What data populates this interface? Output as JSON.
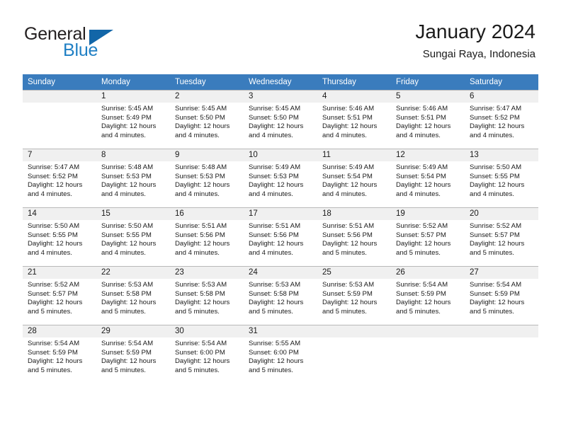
{
  "brand": {
    "name_top": "General",
    "name_bottom": "Blue",
    "triangle_icon": "blue-triangle-icon",
    "accent_color": "#1f7fc4",
    "header_color": "#3a7cbd"
  },
  "header": {
    "title": "January 2024",
    "subtitle": "Sungai Raya, Indonesia"
  },
  "calendar": {
    "weekday_headers": [
      "Sunday",
      "Monday",
      "Tuesday",
      "Wednesday",
      "Thursday",
      "Friday",
      "Saturday"
    ],
    "weeks": [
      [
        {
          "day": "",
          "sunrise": "",
          "sunset": "",
          "daylight1": "",
          "daylight2": ""
        },
        {
          "day": "1",
          "sunrise": "Sunrise: 5:45 AM",
          "sunset": "Sunset: 5:49 PM",
          "daylight1": "Daylight: 12 hours",
          "daylight2": "and 4 minutes."
        },
        {
          "day": "2",
          "sunrise": "Sunrise: 5:45 AM",
          "sunset": "Sunset: 5:50 PM",
          "daylight1": "Daylight: 12 hours",
          "daylight2": "and 4 minutes."
        },
        {
          "day": "3",
          "sunrise": "Sunrise: 5:45 AM",
          "sunset": "Sunset: 5:50 PM",
          "daylight1": "Daylight: 12 hours",
          "daylight2": "and 4 minutes."
        },
        {
          "day": "4",
          "sunrise": "Sunrise: 5:46 AM",
          "sunset": "Sunset: 5:51 PM",
          "daylight1": "Daylight: 12 hours",
          "daylight2": "and 4 minutes."
        },
        {
          "day": "5",
          "sunrise": "Sunrise: 5:46 AM",
          "sunset": "Sunset: 5:51 PM",
          "daylight1": "Daylight: 12 hours",
          "daylight2": "and 4 minutes."
        },
        {
          "day": "6",
          "sunrise": "Sunrise: 5:47 AM",
          "sunset": "Sunset: 5:52 PM",
          "daylight1": "Daylight: 12 hours",
          "daylight2": "and 4 minutes."
        }
      ],
      [
        {
          "day": "7",
          "sunrise": "Sunrise: 5:47 AM",
          "sunset": "Sunset: 5:52 PM",
          "daylight1": "Daylight: 12 hours",
          "daylight2": "and 4 minutes."
        },
        {
          "day": "8",
          "sunrise": "Sunrise: 5:48 AM",
          "sunset": "Sunset: 5:53 PM",
          "daylight1": "Daylight: 12 hours",
          "daylight2": "and 4 minutes."
        },
        {
          "day": "9",
          "sunrise": "Sunrise: 5:48 AM",
          "sunset": "Sunset: 5:53 PM",
          "daylight1": "Daylight: 12 hours",
          "daylight2": "and 4 minutes."
        },
        {
          "day": "10",
          "sunrise": "Sunrise: 5:49 AM",
          "sunset": "Sunset: 5:53 PM",
          "daylight1": "Daylight: 12 hours",
          "daylight2": "and 4 minutes."
        },
        {
          "day": "11",
          "sunrise": "Sunrise: 5:49 AM",
          "sunset": "Sunset: 5:54 PM",
          "daylight1": "Daylight: 12 hours",
          "daylight2": "and 4 minutes."
        },
        {
          "day": "12",
          "sunrise": "Sunrise: 5:49 AM",
          "sunset": "Sunset: 5:54 PM",
          "daylight1": "Daylight: 12 hours",
          "daylight2": "and 4 minutes."
        },
        {
          "day": "13",
          "sunrise": "Sunrise: 5:50 AM",
          "sunset": "Sunset: 5:55 PM",
          "daylight1": "Daylight: 12 hours",
          "daylight2": "and 4 minutes."
        }
      ],
      [
        {
          "day": "14",
          "sunrise": "Sunrise: 5:50 AM",
          "sunset": "Sunset: 5:55 PM",
          "daylight1": "Daylight: 12 hours",
          "daylight2": "and 4 minutes."
        },
        {
          "day": "15",
          "sunrise": "Sunrise: 5:50 AM",
          "sunset": "Sunset: 5:55 PM",
          "daylight1": "Daylight: 12 hours",
          "daylight2": "and 4 minutes."
        },
        {
          "day": "16",
          "sunrise": "Sunrise: 5:51 AM",
          "sunset": "Sunset: 5:56 PM",
          "daylight1": "Daylight: 12 hours",
          "daylight2": "and 4 minutes."
        },
        {
          "day": "17",
          "sunrise": "Sunrise: 5:51 AM",
          "sunset": "Sunset: 5:56 PM",
          "daylight1": "Daylight: 12 hours",
          "daylight2": "and 4 minutes."
        },
        {
          "day": "18",
          "sunrise": "Sunrise: 5:51 AM",
          "sunset": "Sunset: 5:56 PM",
          "daylight1": "Daylight: 12 hours",
          "daylight2": "and 5 minutes."
        },
        {
          "day": "19",
          "sunrise": "Sunrise: 5:52 AM",
          "sunset": "Sunset: 5:57 PM",
          "daylight1": "Daylight: 12 hours",
          "daylight2": "and 5 minutes."
        },
        {
          "day": "20",
          "sunrise": "Sunrise: 5:52 AM",
          "sunset": "Sunset: 5:57 PM",
          "daylight1": "Daylight: 12 hours",
          "daylight2": "and 5 minutes."
        }
      ],
      [
        {
          "day": "21",
          "sunrise": "Sunrise: 5:52 AM",
          "sunset": "Sunset: 5:57 PM",
          "daylight1": "Daylight: 12 hours",
          "daylight2": "and 5 minutes."
        },
        {
          "day": "22",
          "sunrise": "Sunrise: 5:53 AM",
          "sunset": "Sunset: 5:58 PM",
          "daylight1": "Daylight: 12 hours",
          "daylight2": "and 5 minutes."
        },
        {
          "day": "23",
          "sunrise": "Sunrise: 5:53 AM",
          "sunset": "Sunset: 5:58 PM",
          "daylight1": "Daylight: 12 hours",
          "daylight2": "and 5 minutes."
        },
        {
          "day": "24",
          "sunrise": "Sunrise: 5:53 AM",
          "sunset": "Sunset: 5:58 PM",
          "daylight1": "Daylight: 12 hours",
          "daylight2": "and 5 minutes."
        },
        {
          "day": "25",
          "sunrise": "Sunrise: 5:53 AM",
          "sunset": "Sunset: 5:59 PM",
          "daylight1": "Daylight: 12 hours",
          "daylight2": "and 5 minutes."
        },
        {
          "day": "26",
          "sunrise": "Sunrise: 5:54 AM",
          "sunset": "Sunset: 5:59 PM",
          "daylight1": "Daylight: 12 hours",
          "daylight2": "and 5 minutes."
        },
        {
          "day": "27",
          "sunrise": "Sunrise: 5:54 AM",
          "sunset": "Sunset: 5:59 PM",
          "daylight1": "Daylight: 12 hours",
          "daylight2": "and 5 minutes."
        }
      ],
      [
        {
          "day": "28",
          "sunrise": "Sunrise: 5:54 AM",
          "sunset": "Sunset: 5:59 PM",
          "daylight1": "Daylight: 12 hours",
          "daylight2": "and 5 minutes."
        },
        {
          "day": "29",
          "sunrise": "Sunrise: 5:54 AM",
          "sunset": "Sunset: 5:59 PM",
          "daylight1": "Daylight: 12 hours",
          "daylight2": "and 5 minutes."
        },
        {
          "day": "30",
          "sunrise": "Sunrise: 5:54 AM",
          "sunset": "Sunset: 6:00 PM",
          "daylight1": "Daylight: 12 hours",
          "daylight2": "and 5 minutes."
        },
        {
          "day": "31",
          "sunrise": "Sunrise: 5:55 AM",
          "sunset": "Sunset: 6:00 PM",
          "daylight1": "Daylight: 12 hours",
          "daylight2": "and 5 minutes."
        },
        {
          "day": "",
          "sunrise": "",
          "sunset": "",
          "daylight1": "",
          "daylight2": ""
        },
        {
          "day": "",
          "sunrise": "",
          "sunset": "",
          "daylight1": "",
          "daylight2": ""
        },
        {
          "day": "",
          "sunrise": "",
          "sunset": "",
          "daylight1": "",
          "daylight2": ""
        }
      ]
    ]
  }
}
